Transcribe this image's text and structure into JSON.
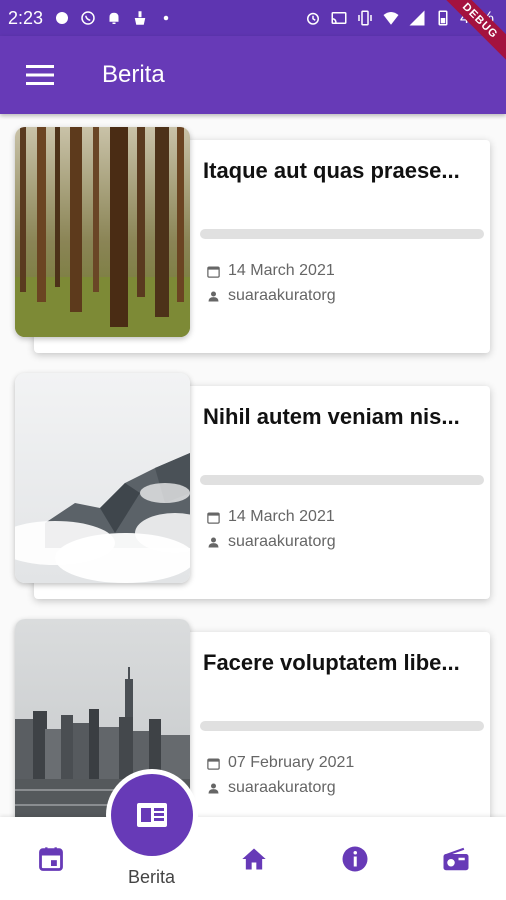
{
  "status_bar": {
    "time": "2:23",
    "battery": "45%",
    "left_icons": [
      "sync-icon",
      "whatsapp-icon",
      "notification-bell-icon",
      "cleaner-icon",
      "dot-icon"
    ],
    "right_icons": [
      "alarm-icon",
      "cast-icon",
      "vibrate-icon",
      "wifi-icon",
      "signal-icon",
      "battery-icon"
    ]
  },
  "debug_banner": "DEBUG",
  "app_bar": {
    "title": "Berita",
    "menu_icon": "menu-icon"
  },
  "articles": [
    {
      "title": "Itaque aut quas praese...",
      "date": "14 March 2021",
      "author": "suaraakuratorg",
      "image": "forest"
    },
    {
      "title": "Nihil autem veniam nis...",
      "date": "14 March 2021",
      "author": "suaraakuratorg",
      "image": "misty-mountain"
    },
    {
      "title": "Facere voluptatem libe...",
      "date": "07 February 2021",
      "author": "suaraakuratorg",
      "image": "city-skyline"
    }
  ],
  "bottom_nav": {
    "items": [
      {
        "icon": "calendar-icon"
      },
      {
        "icon": "news-icon",
        "label": "Berita",
        "active": true
      },
      {
        "icon": "home-icon"
      },
      {
        "icon": "info-icon"
      },
      {
        "icon": "radio-icon"
      }
    ]
  },
  "colors": {
    "primary": "#673ab7",
    "status_bar": "#5e35b1",
    "debug": "#a4123f"
  }
}
